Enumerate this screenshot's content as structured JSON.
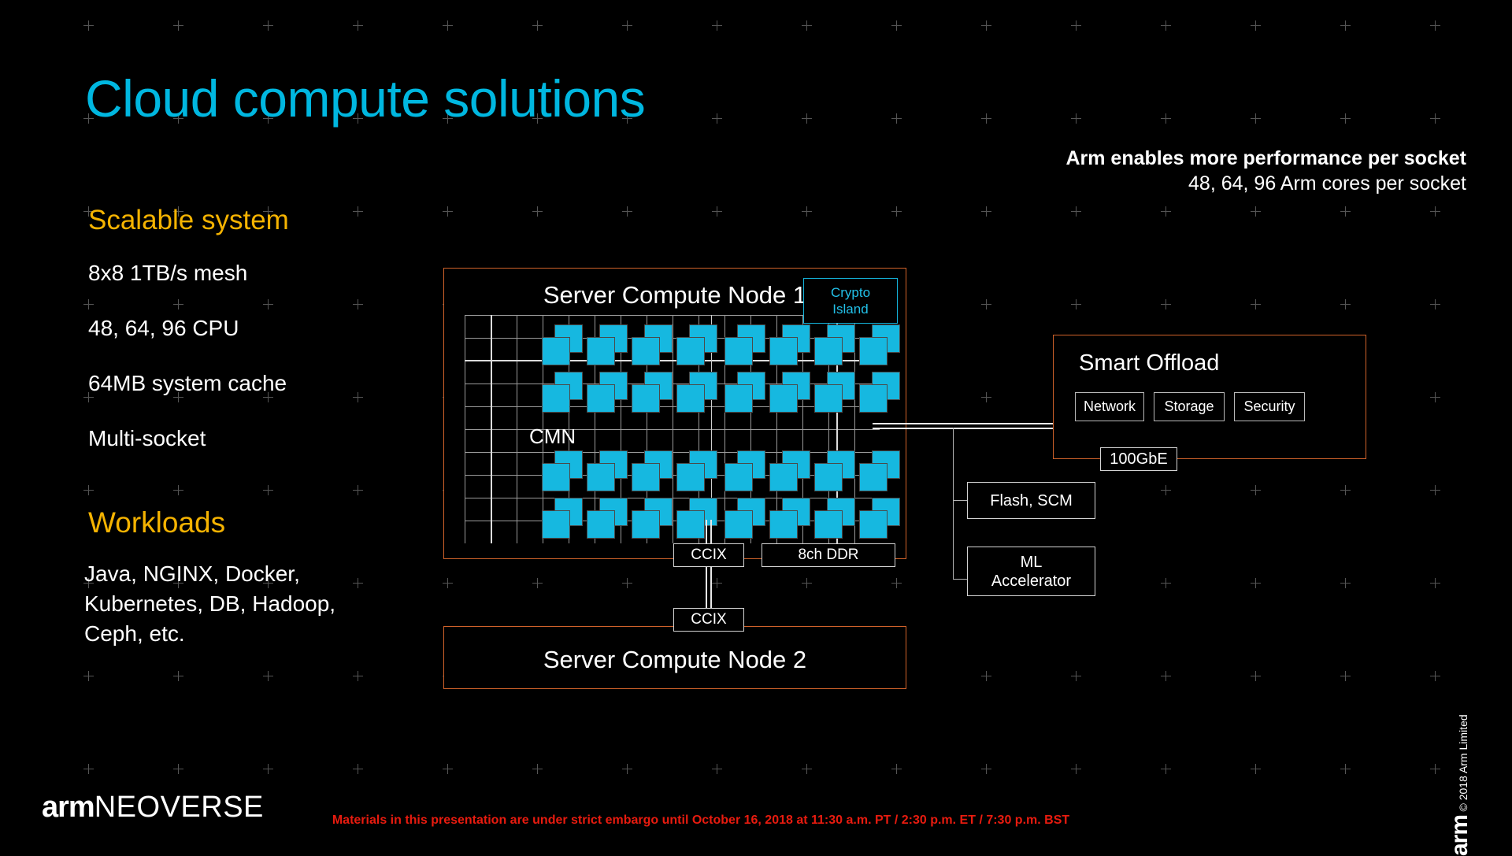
{
  "slide": {
    "title": "Cloud compute solutions",
    "title_color": "#00b7e0",
    "background_color": "#000000",
    "accent_orange": "#d0622a",
    "accent_amber": "#f5b301",
    "accent_cyan": "#16b8e0"
  },
  "left": {
    "section1_heading": "Scalable system",
    "bullets": [
      "8x8 1TB/s mesh",
      "48, 64, 96 CPU",
      "64MB system cache",
      "Multi-socket"
    ],
    "section2_heading": "Workloads",
    "workloads_text": "Java, NGINX, Docker,\nKubernetes, DB, Hadoop,\nCeph, etc."
  },
  "headline": {
    "line1": "Arm enables more performance per socket",
    "line2": "48, 64, 96 Arm cores per socket"
  },
  "diagram": {
    "node1_label": "Server Compute Node 1",
    "node2_label": "Server Compute Node  2",
    "mesh_label": "CMN",
    "crypto_island": "Crypto\nIsland",
    "crypto_island_line1": "Crypto",
    "crypto_island_line2": "Island",
    "ccix_top": "CCIX",
    "ccix_bottom": "CCIX",
    "ddr": "8ch DDR",
    "ethernet": "100GbE",
    "flash": "Flash, SCM",
    "ml_line1": "ML",
    "ml_line2": "Accelerator",
    "offload_title": "Smart Offload",
    "offload_boxes": [
      "Network",
      "Storage",
      "Security"
    ],
    "mesh_rows": 4,
    "mesh_cols_per_half": 4,
    "cpu_clusters_total": 32
  },
  "footer": {
    "embargo": "Materials in this presentation are under strict embargo until October 16, 2018 at 11:30 a.m. PT / 2:30 p.m. ET / 7:30 p.m. BST",
    "embargo_color": "#e81b0f",
    "logo_brand": "arm",
    "logo_product": "NEOVERSE",
    "sidebar_brand": "arm",
    "sidebar_copyright": "© 2018 Arm Limited"
  }
}
